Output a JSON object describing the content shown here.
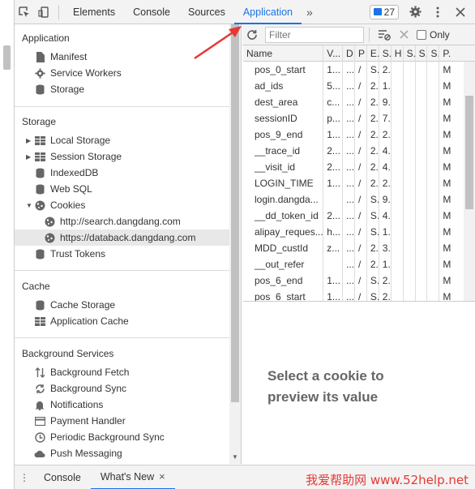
{
  "toolbar": {
    "tabs": [
      "Elements",
      "Console",
      "Sources",
      "Application"
    ],
    "more": "»",
    "badge_count": "27"
  },
  "sidebar": {
    "application": {
      "title": "Application",
      "items": [
        "Manifest",
        "Service Workers",
        "Storage"
      ]
    },
    "storage": {
      "title": "Storage",
      "items": [
        "Local Storage",
        "Session Storage",
        "IndexedDB",
        "Web SQL",
        "Cookies"
      ],
      "cookies": [
        "http://search.dangdang.com",
        "https://databack.dangdang.com"
      ],
      "trust": "Trust Tokens"
    },
    "cache": {
      "title": "Cache",
      "items": [
        "Cache Storage",
        "Application Cache"
      ]
    },
    "background": {
      "title": "Background Services",
      "items": [
        "Background Fetch",
        "Background Sync",
        "Notifications",
        "Payment Handler",
        "Periodic Background Sync",
        "Push Messaging"
      ]
    }
  },
  "cookies_toolbar": {
    "filter_placeholder": "Filter",
    "only_label": "Only"
  },
  "table": {
    "columns": [
      "Name",
      "V...",
      "D",
      "P",
      "E.",
      "S.",
      "H",
      "S.",
      "S.",
      "S.",
      "P."
    ],
    "rows": [
      {
        "name": "pos_0_start",
        "v": "1...",
        "d": "...",
        "p": "/",
        "e": "S.",
        "s": "2."
      },
      {
        "name": "ad_ids",
        "v": "5...",
        "d": "...",
        "p": "/",
        "e": "2.",
        "s": "1."
      },
      {
        "name": "dest_area",
        "v": "c...",
        "d": "...",
        "p": "/",
        "e": "2.",
        "s": "9."
      },
      {
        "name": "sessionID",
        "v": "p...",
        "d": "...",
        "p": "/",
        "e": "2.",
        "s": "7."
      },
      {
        "name": "pos_9_end",
        "v": "1...",
        "d": "...",
        "p": "/",
        "e": "2.",
        "s": "2."
      },
      {
        "name": "__trace_id",
        "v": "2...",
        "d": "...",
        "p": "/",
        "e": "2.",
        "s": "4."
      },
      {
        "name": "__visit_id",
        "v": "2...",
        "d": "...",
        "p": "/",
        "e": "2.",
        "s": "4."
      },
      {
        "name": "LOGIN_TIME",
        "v": "1...",
        "d": "...",
        "p": "/",
        "e": "2.",
        "s": "2."
      },
      {
        "name": "login.dangda...",
        "v": "",
        "d": "...",
        "p": "/",
        "e": "S.",
        "s": "9."
      },
      {
        "name": "__dd_token_id",
        "v": "2...",
        "d": "...",
        "p": "/",
        "e": "S.",
        "s": "4."
      },
      {
        "name": "alipay_reques...",
        "v": "h...",
        "d": "...",
        "p": "/",
        "e": "S.",
        "s": "1."
      },
      {
        "name": "MDD_custId",
        "v": "z...",
        "d": "...",
        "p": "/",
        "e": "2.",
        "s": "3."
      },
      {
        "name": "__out_refer",
        "v": "",
        "d": "...",
        "p": "/",
        "e": "2.",
        "s": "1."
      },
      {
        "name": "pos_6_end",
        "v": "1...",
        "d": "...",
        "p": "/",
        "e": "S.",
        "s": "2."
      },
      {
        "name": "pos_6_start",
        "v": "1...",
        "d": "...",
        "p": "/",
        "e": "S.",
        "s": "2."
      }
    ],
    "last_col": "M"
  },
  "preview": {
    "message": "Select a cookie to preview its value"
  },
  "drawer": {
    "tabs": [
      "Console",
      "What's New"
    ],
    "close": "×"
  },
  "watermark": "我爱帮助网 www.52help.net"
}
